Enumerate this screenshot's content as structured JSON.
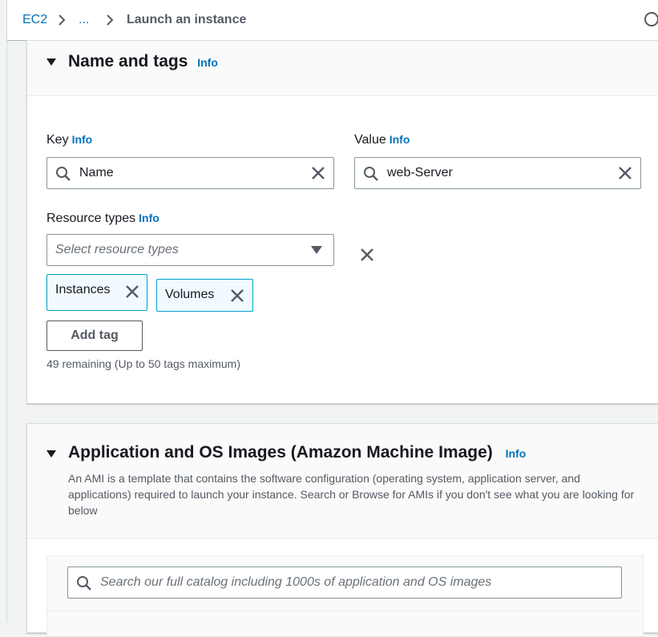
{
  "breadcrumb": {
    "root": "EC2",
    "separator": ">",
    "ellipsis": "...",
    "current": "Launch an instance"
  },
  "name_and_tags": {
    "title": "Name and tags",
    "info": "Info",
    "key_label": "Key",
    "key_info": "Info",
    "key_value": "Name",
    "value_label": "Value",
    "value_info": "Info",
    "value_value": "web-Server",
    "resource_types_label": "Resource types",
    "resource_types_info": "Info",
    "resource_types_placeholder": "Select resource types",
    "tokens": [
      "Instances",
      "Volumes"
    ],
    "add_tag_button": "Add tag",
    "remaining_hint": "49 remaining (Up to 50 tags maximum)"
  },
  "ami": {
    "title": "Application and OS Images (Amazon Machine Image)",
    "info": "Info",
    "description": "An AMI is a template that contains the software configuration (operating system, application server, and applications) required to launch your instance. Search or Browse for AMIs if you don't see what you are looking for below",
    "search_placeholder": "Search our full catalog including 1000s of application and OS images"
  },
  "icons": {
    "search": "search-icon",
    "clear": "close-icon",
    "dropdown": "caret-down-icon",
    "collapse": "caret-down-icon",
    "help": "help-circle-icon"
  },
  "colors": {
    "link": "#0073bb",
    "token_bg": "#f1faff",
    "token_border": "#00a1c9",
    "page_bg": "#f2f3f3"
  }
}
